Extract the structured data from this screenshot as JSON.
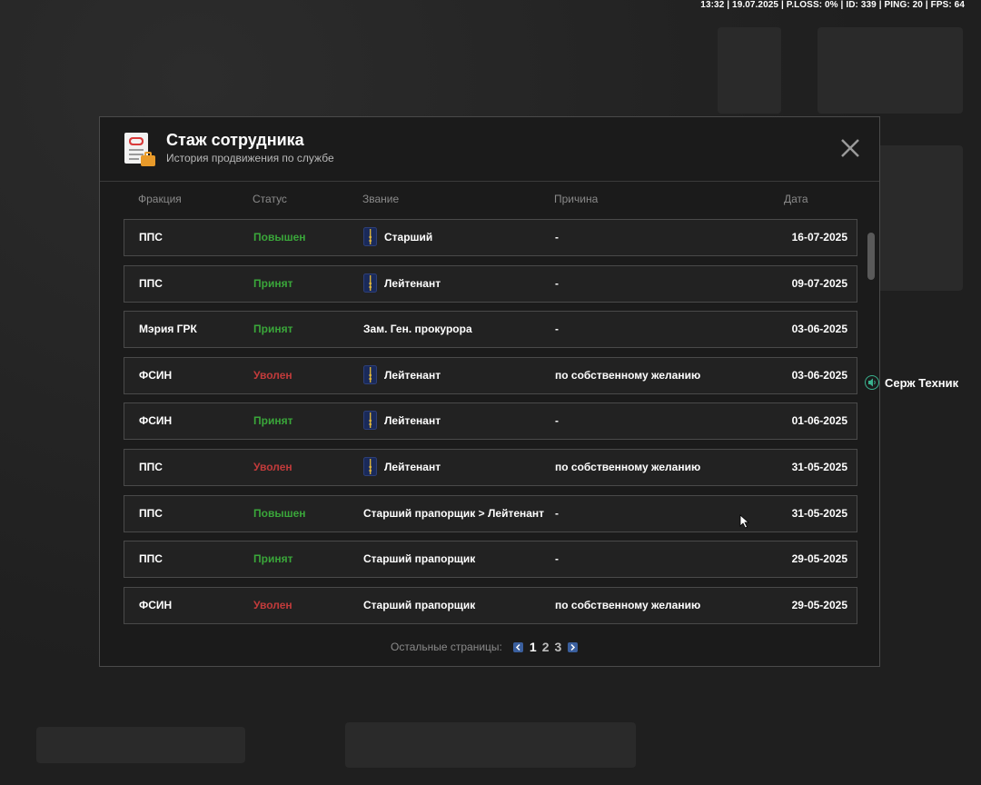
{
  "hud": {
    "text": "13:32 | 19.07.2025 | P.LOSS: 0% | ID: 339 | PING: 20 | FPS: 64"
  },
  "modal": {
    "title": "Стаж сотрудника",
    "subtitle": "История продвижения по службе",
    "icon": "document-icon"
  },
  "columns": [
    "Фракция",
    "Статус",
    "Звание",
    "Причина",
    "Дата"
  ],
  "rows": [
    {
      "fraction": "ППС",
      "status": "Повышен",
      "status_type": "green",
      "rank_icon": true,
      "rank": "Старший",
      "reason": "-",
      "date": "16-07-2025"
    },
    {
      "fraction": "ППС",
      "status": "Принят",
      "status_type": "green",
      "rank_icon": true,
      "rank": "Лейтенант",
      "reason": "-",
      "date": "09-07-2025"
    },
    {
      "fraction": "Мэрия ГРК",
      "status": "Принят",
      "status_type": "green",
      "rank_icon": false,
      "rank": "Зам. Ген. прокурора",
      "reason": "-",
      "date": "03-06-2025"
    },
    {
      "fraction": "ФСИН",
      "status": "Уволен",
      "status_type": "red",
      "rank_icon": true,
      "rank": "Лейтенант",
      "reason": "по собственному желанию",
      "date": "03-06-2025"
    },
    {
      "fraction": "ФСИН",
      "status": "Принят",
      "status_type": "green",
      "rank_icon": true,
      "rank": "Лейтенант",
      "reason": "-",
      "date": "01-06-2025"
    },
    {
      "fraction": "ППС",
      "status": "Уволен",
      "status_type": "red",
      "rank_icon": true,
      "rank": "Лейтенант",
      "reason": "по собственному желанию",
      "date": "31-05-2025"
    },
    {
      "fraction": "ППС",
      "status": "Повышен",
      "status_type": "green",
      "rank_icon": false,
      "rank": "Старший прапорщик > Лейтенант",
      "reason": "-",
      "date": "31-05-2025"
    },
    {
      "fraction": "ППС",
      "status": "Принят",
      "status_type": "green",
      "rank_icon": false,
      "rank": "Старший прапорщик",
      "reason": "-",
      "date": "29-05-2025"
    },
    {
      "fraction": "ФСИН",
      "status": "Уволен",
      "status_type": "red",
      "rank_icon": false,
      "rank": "Старший прапорщик",
      "reason": "по собственному желанию",
      "date": "29-05-2025"
    }
  ],
  "pager": {
    "label": "Остальные страницы:",
    "pages": [
      "1",
      "2",
      "3"
    ],
    "current": "1"
  },
  "side_player": {
    "name": "Серж Техник"
  },
  "colors": {
    "status_green": "#3aa63a",
    "status_red": "#c23b3b",
    "accent_blue": "#3a5f9e"
  }
}
